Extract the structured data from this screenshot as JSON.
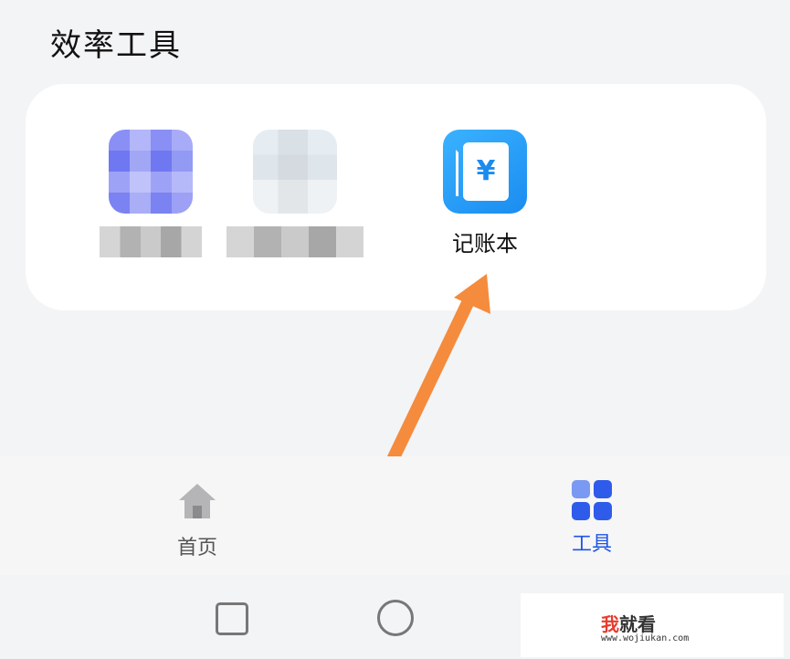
{
  "header": {
    "title": "效率工具"
  },
  "tools": [
    {
      "label": "",
      "icon": "blurred-app-icon-1"
    },
    {
      "label": "",
      "icon": "blurred-app-icon-2"
    },
    {
      "label": "记账本",
      "icon": "ledger-yuan-icon",
      "glyph": "¥"
    }
  ],
  "nav": {
    "home_label": "首页",
    "tools_label": "工具",
    "active": "工具",
    "active_color": "#1f54e6"
  },
  "watermark": {
    "brand_red": "我",
    "brand_rest": "就看",
    "url": "www.wojiukan.com"
  },
  "colors": {
    "arrow": "#f58b3c",
    "ledger_icon": "#1a8cf0"
  }
}
